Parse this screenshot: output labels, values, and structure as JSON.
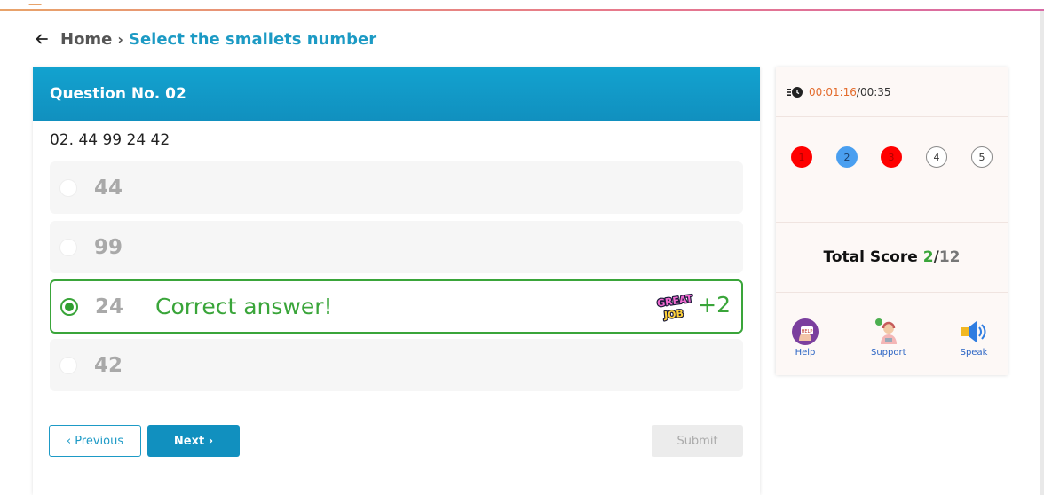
{
  "breadcrumb": {
    "home": "Home",
    "separator": "›",
    "current": "Select the smallets number"
  },
  "question": {
    "header": "Question No. 02",
    "text": "02. 44 99 24 42",
    "options": [
      {
        "value": "44",
        "state": "unselected"
      },
      {
        "value": "99",
        "state": "unselected"
      },
      {
        "value": "24",
        "state": "correct"
      },
      {
        "value": "42",
        "state": "unselected"
      }
    ],
    "feedback": "Correct answer!",
    "points": "+2",
    "badge_text": "GREAT JOB"
  },
  "buttons": {
    "previous": "‹ Previous",
    "next": "Next ›",
    "submit": "Submit"
  },
  "timer": {
    "elapsed": "00:01:16",
    "separator": "/",
    "limit": "00:35"
  },
  "progress": [
    {
      "label": "1",
      "status": "wrong"
    },
    {
      "label": "2",
      "status": "current"
    },
    {
      "label": "3",
      "status": "wrong"
    },
    {
      "label": "4",
      "status": "pending"
    },
    {
      "label": "5",
      "status": "pending"
    }
  ],
  "score": {
    "label": "Total Score",
    "got": "2",
    "slash": "/",
    "total": "12"
  },
  "tools": {
    "help": "Help",
    "support": "Support",
    "speak": "Speak",
    "help_icon_text": "HELP"
  },
  "colors": {
    "accent": "#1190bf",
    "correct": "#3aa53a",
    "wrong": "#ff0000",
    "current": "#4a9ff0",
    "timer": "#e36b2c"
  }
}
